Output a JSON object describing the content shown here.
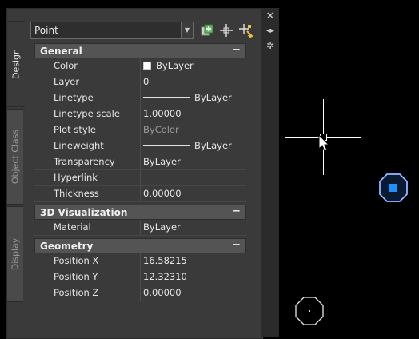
{
  "palette": {
    "tabs": [
      {
        "label": "Design",
        "active": true
      },
      {
        "label": "Object Class",
        "active": false
      },
      {
        "label": "Display",
        "active": false
      }
    ],
    "selected_object": "Point",
    "titlebar": {
      "close_icon": "close-icon",
      "autohide_icon": "autohide-icon",
      "settings_icon": "settings-icon"
    }
  },
  "categories": {
    "general": {
      "label": "General",
      "toggle": "−",
      "rows": [
        {
          "name": "Color",
          "value": "ByLayer"
        },
        {
          "name": "Layer",
          "value": "0"
        },
        {
          "name": "Linetype",
          "value": "ByLayer"
        },
        {
          "name": "Linetype scale",
          "value": "1.00000"
        },
        {
          "name": "Plot style",
          "value": "ByColor"
        },
        {
          "name": "Lineweight",
          "value": "ByLayer"
        },
        {
          "name": "Transparency",
          "value": "ByLayer"
        },
        {
          "name": "Hyperlink",
          "value": ""
        },
        {
          "name": "Thickness",
          "value": "0.00000"
        }
      ]
    },
    "visualization3d": {
      "label": "3D Visualization",
      "toggle": "−",
      "rows": [
        {
          "name": "Material",
          "value": "ByLayer"
        }
      ]
    },
    "geometry": {
      "label": "Geometry",
      "toggle": "−",
      "rows": [
        {
          "name": "Position X",
          "value": "16.58215"
        },
        {
          "name": "Position Y",
          "value": "12.32310"
        },
        {
          "name": "Position Z",
          "value": "0.00000"
        }
      ]
    }
  },
  "colors": {
    "grip_blue": "#1e90ff",
    "canvas": "#000000",
    "panel": "#3a3a3a"
  }
}
